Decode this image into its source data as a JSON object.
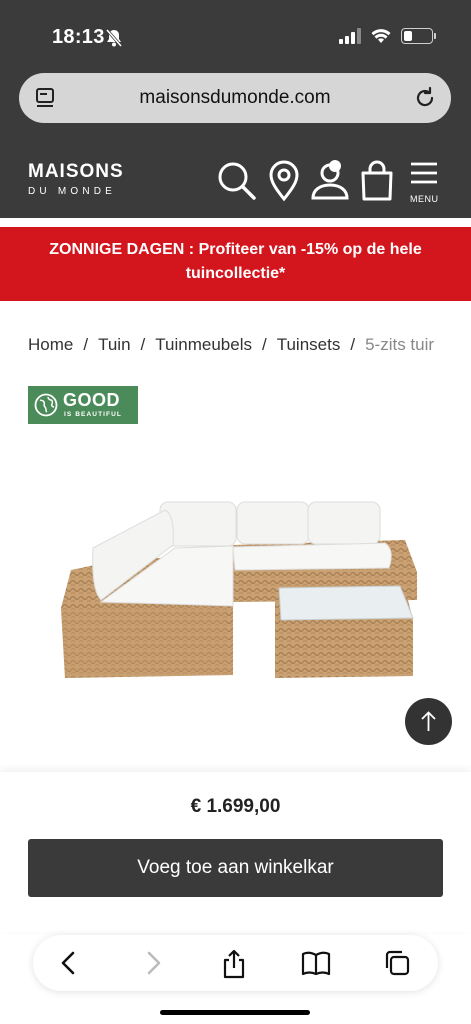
{
  "status_bar": {
    "time": "18:13"
  },
  "browser": {
    "url": "maisonsdumonde.com"
  },
  "header": {
    "logo_main": "MAISONS",
    "logo_sub": "DU MONDE",
    "menu_label": "MENU"
  },
  "promo": {
    "text": "ZONNIGE DAGEN : Profiteer van -15% op de hele tuincollectie*"
  },
  "breadcrumb": {
    "items": [
      "Home",
      "Tuin",
      "Tuinmeubels",
      "Tuinsets"
    ],
    "separator": "/",
    "current": "5-zits tuir"
  },
  "badge": {
    "word": "GOOD",
    "sub": "IS BEAUTIFUL"
  },
  "product": {
    "price": "€ 1.699,00"
  },
  "actions": {
    "add_to_cart": "Voeg toe aan winkelkar"
  },
  "colors": {
    "promo_red": "#d3151d",
    "header_dark": "#3b3b3b",
    "badge_green": "#4b8b5a"
  }
}
